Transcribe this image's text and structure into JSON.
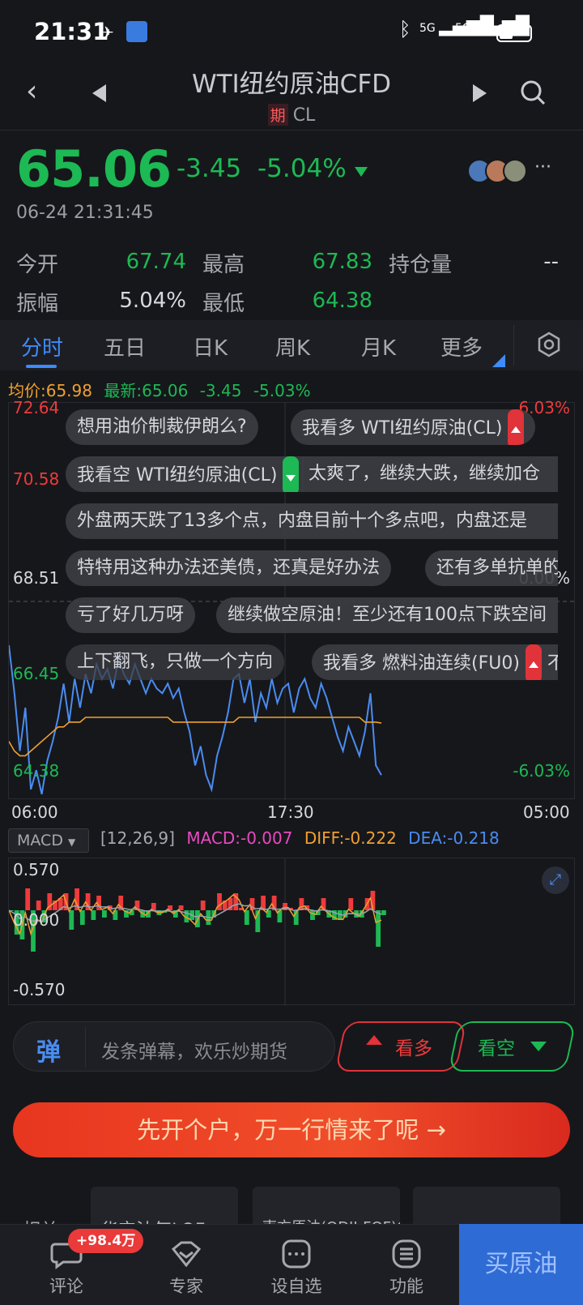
{
  "status_bar": {
    "time": "21:31",
    "network1": "5G",
    "network2": "5G"
  },
  "header": {
    "title": "WTI纽约原油CFD",
    "tag": "期",
    "code": "CL"
  },
  "quote": {
    "price": "65.06",
    "change": "-3.45",
    "change_pct": "-5.04%",
    "datetime": "06-24 21:31:45",
    "more": "···",
    "stats": {
      "open_label": "今开",
      "open": "67.74",
      "high_label": "最高",
      "high": "67.83",
      "oi_label": "持仓量",
      "oi": "--",
      "amp_label": "振幅",
      "amp": "5.04%",
      "low_label": "最低",
      "low": "64.38"
    }
  },
  "tabs": [
    "分时",
    "五日",
    "日K",
    "周K",
    "月K",
    "更多"
  ],
  "info_line": {
    "avg": "均价:65.98",
    "latest": "最新:65.06",
    "chg": "-3.45",
    "pct": "-5.03%"
  },
  "chart_axis": {
    "y_left": [
      "72.64",
      "70.58",
      "68.51",
      "66.45",
      "64.38"
    ],
    "y_right_top": "6.03%",
    "y_right_mid": "0.00%",
    "y_right_bottom": "-6.03%",
    "x": [
      "06:00",
      "17:30",
      "05:00"
    ]
  },
  "danmu": [
    "想用油价制裁伊朗么?",
    "我看多 WTI纽约原油(CL)",
    "我看空 WTI纽约原油(CL)",
    "太爽了，继续大跌，继续加仓",
    "外盘两天跌了13多个点，内盘目前十个多点吧，内盘还是",
    "特特用这种办法还美债，还真是好办法",
    "还有多单抗单的",
    "亏了好几万呀",
    "继续做空原油！至少还有100点下跌空间",
    "上下翻飞，只做一个方向",
    "我看多 燃料油连续(FU0)",
    "不"
  ],
  "macd": {
    "selector": "MACD",
    "params": "[12,26,9]",
    "macd": "MACD:-0.007",
    "diff": "DIFF:-0.222",
    "dea": "DEA:-0.218",
    "y_top": "0.570",
    "y_mid": "0.000",
    "y_bottom": "-0.570"
  },
  "comment_bar": {
    "icon": "弹",
    "placeholder": "发条弹幕，欢乐炒期货",
    "bull": "看多",
    "bear": "看空"
  },
  "cta": "先开个户，万一行情来了呢 →",
  "cards": [
    "相关",
    "华宝油气LOF",
    "南方原油(QDII-FOF)C",
    ""
  ],
  "bottom_nav": {
    "comment": "评论",
    "expert": "专家",
    "watch": "设自选",
    "func": "功能",
    "buy": "买原油",
    "badge": "+98.4万"
  },
  "colors": {
    "up": "#ee3b3b",
    "down": "#1db954",
    "accent": "#3d8bff",
    "avg_line": "#f0a030",
    "price_line": "#4a8cf0"
  },
  "chart_data": {
    "type": "line",
    "title": "",
    "x_labels": [
      "06:00",
      "17:30",
      "05:00"
    ],
    "ylim": [
      64.38,
      72.64
    ],
    "series": [
      {
        "name": "最新",
        "values": [
          67.6,
          66.6,
          65.4,
          66.3,
          64.6,
          65.0,
          64.5,
          65.2,
          65.6,
          66.1,
          66.8,
          66.0,
          66.9,
          66.3,
          67.0,
          66.6,
          67.2,
          66.9,
          67.1,
          66.7,
          67.3,
          67.0,
          66.8,
          67.2,
          66.9,
          66.6,
          66.9,
          66.7,
          66.6,
          66.8,
          66.5,
          66.7,
          66.2,
          65.8,
          65.1,
          65.5,
          64.9,
          64.6,
          65.3,
          65.7,
          66.2,
          66.9,
          67.0,
          66.4,
          66.9,
          66.0,
          66.6,
          66.3,
          66.9,
          66.4,
          66.7,
          66.8,
          66.2,
          66.7,
          66.9,
          66.5,
          66.3,
          66.8,
          66.5,
          66.1,
          65.7,
          65.4,
          65.9,
          65.6,
          65.3,
          65.8,
          66.6,
          65.1,
          64.9
        ]
      },
      {
        "name": "均价",
        "values": [
          65.6,
          65.4,
          65.3,
          65.3,
          65.4,
          65.5,
          65.6,
          65.7,
          65.8,
          65.9,
          65.9,
          66.0,
          66.0,
          66.0,
          66.1,
          66.1,
          66.1,
          66.1,
          66.1,
          66.1,
          66.1,
          66.1,
          66.1,
          66.1,
          66.1,
          66.1,
          66.1,
          66.1,
          66.1,
          66.1,
          66.0,
          66.0,
          66.0,
          66.0,
          66.0,
          66.0,
          66.0,
          66.0,
          66.0,
          66.0,
          66.0,
          66.0,
          66.1,
          66.1,
          66.1,
          66.1,
          66.1,
          66.1,
          66.1,
          66.1,
          66.1,
          66.1,
          66.1,
          66.1,
          66.1,
          66.1,
          66.1,
          66.1,
          66.1,
          66.1,
          66.1,
          66.1,
          66.1,
          66.1,
          66.1,
          66.0,
          66.0,
          66.0,
          65.98
        ]
      }
    ]
  }
}
